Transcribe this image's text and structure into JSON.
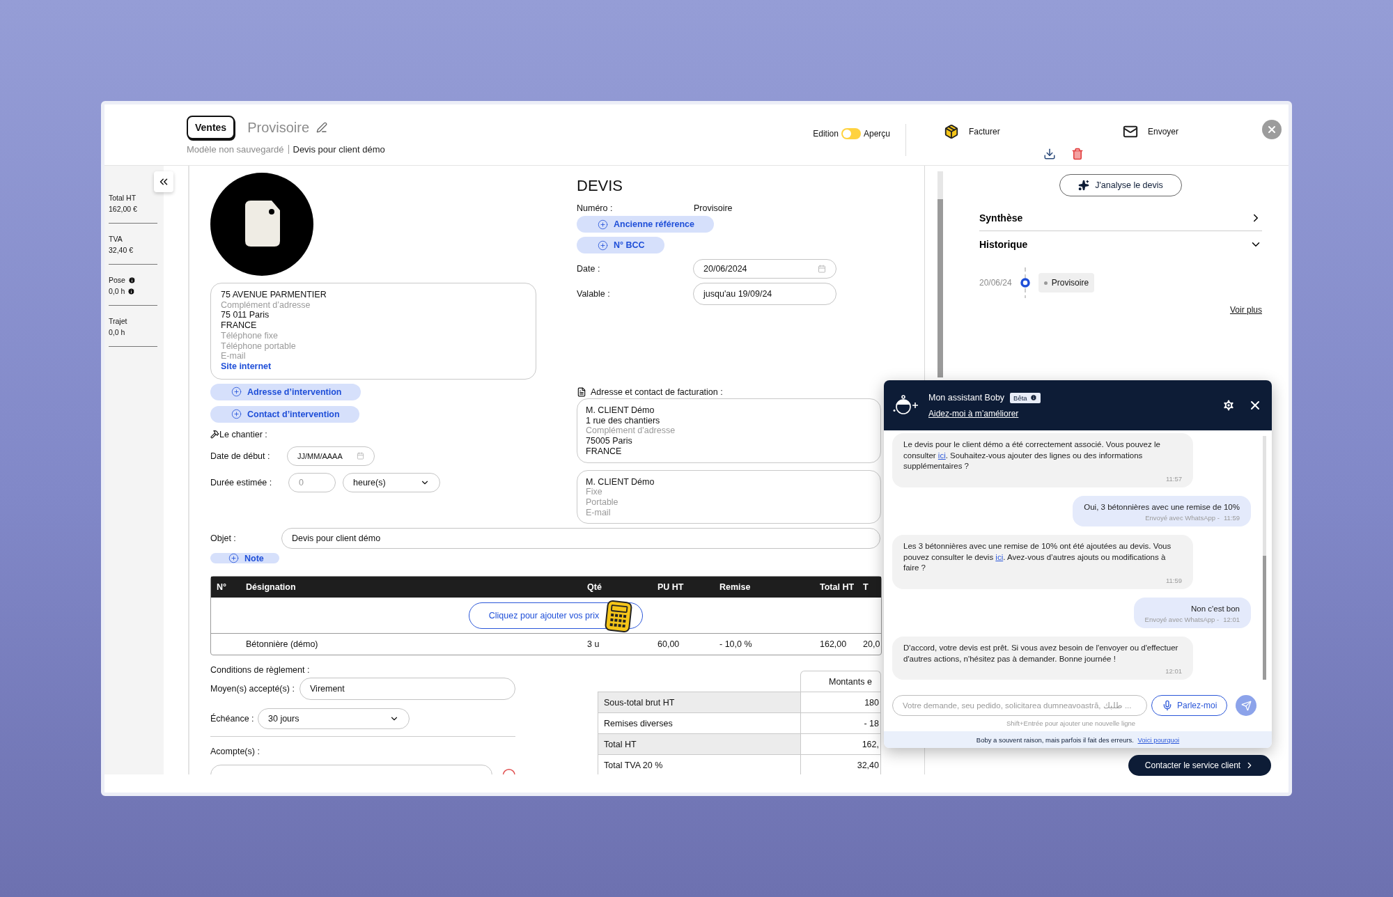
{
  "header": {
    "module": "Ventes",
    "status": "Provisoire",
    "template_note": "Modèle non sauvegardé",
    "document_name": "Devis pour client démo",
    "mode_toggle": {
      "left_label": "Edition",
      "right_label": "Aperçu",
      "on": false
    },
    "actions": [
      {
        "label": "Facturer",
        "kind": "invoice"
      },
      {
        "label": "Envoyer",
        "kind": "send"
      }
    ]
  },
  "summary_sidebar": [
    {
      "label": "Total HT",
      "value": "162,00 €",
      "info": false
    },
    {
      "label": "TVA",
      "value": "32,40 €",
      "info": false
    },
    {
      "label": "Pose",
      "value": "0,0 h",
      "info": true
    },
    {
      "label": "Trajet",
      "value": "0,0 h",
      "info": false
    }
  ],
  "company": {
    "lines": [
      {
        "text": "75 AVENUE PARMENTIER",
        "kind": "value"
      },
      {
        "text": "Complément d’adresse",
        "kind": "placeholder"
      },
      {
        "text": "75 011 Paris",
        "kind": "value"
      },
      {
        "text": "FRANCE",
        "kind": "value"
      },
      {
        "text": "Téléphone fixe",
        "kind": "placeholder"
      },
      {
        "text": "Téléphone portable",
        "kind": "placeholder"
      },
      {
        "text": "E-mail",
        "kind": "placeholder"
      },
      {
        "text": "Site internet",
        "kind": "link"
      }
    ]
  },
  "intervention_buttons": [
    "Adresse d’intervention",
    "Contact d’intervention"
  ],
  "site": {
    "title": "Le chantier :",
    "start_label": "Date de début :",
    "start_placeholder": "JJ/MM/AAAA",
    "duration_label": "Durée estimée :",
    "duration_placeholder": "0",
    "unit": "heure(s)"
  },
  "document": {
    "title": "DEVIS",
    "number_label": "Numéro :",
    "number": "Provisoire",
    "ref_buttons": [
      "Ancienne référence",
      "N° BCC"
    ],
    "date_label": "Date :",
    "date": "20/06/2024",
    "validity_label": "Valable :",
    "validity": "jusqu'au 19/09/24"
  },
  "billing": {
    "title": "Adresse et contact de facturation :",
    "address_lines": [
      {
        "text": "M. CLIENT Démo",
        "kind": "value"
      },
      {
        "text": "1 rue des chantiers",
        "kind": "value"
      },
      {
        "text": "Complément d'adresse",
        "kind": "placeholder"
      },
      {
        "text": "75005  Paris",
        "kind": "value"
      },
      {
        "text": "FRANCE",
        "kind": "value"
      }
    ],
    "contact_lines": [
      {
        "text": "M.  CLIENT Démo",
        "kind": "value"
      },
      {
        "text": "Fixe",
        "kind": "placeholder"
      },
      {
        "text": "Portable",
        "kind": "placeholder"
      },
      {
        "text": "E-mail",
        "kind": "placeholder"
      }
    ]
  },
  "object": {
    "label": "Objet :",
    "value": "Devis pour client démo"
  },
  "note_button": "Note",
  "lines_table": {
    "columns": [
      "N°",
      "Désignation",
      "Qté",
      "PU HT",
      "Remise",
      "Total HT",
      "T"
    ],
    "add_prices_button": "Cliquez pour ajouter vos prix",
    "rows": [
      {
        "designation": "Bétonnière (démo)",
        "qty": "3 u",
        "unit_price": "60,00",
        "discount": "- 10,0 %",
        "total": "162,00",
        "column_7": "20,0"
      }
    ]
  },
  "payment": {
    "title": "Conditions de règlement :",
    "methods_label": "Moyen(s) accepté(s) :",
    "methods": "Virement",
    "due_label": "Échéance :",
    "due": "30 jours",
    "deposit_label": "Acompte(s) :"
  },
  "totals": {
    "header": "Montants e",
    "rows": [
      {
        "label": "Sous-total brut HT",
        "value": "180",
        "shaded": true
      },
      {
        "label": "Remises diverses",
        "value": "- 18",
        "shaded": false
      },
      {
        "label": "Total HT",
        "value": "162,",
        "shaded": true
      },
      {
        "label": "Total TVA 20 %",
        "value": "32,40",
        "shaded": false
      }
    ]
  },
  "side_panel": {
    "analyse_button": "J'analyse le devis",
    "sections": [
      {
        "title": "Synthèse",
        "expanded": false
      },
      {
        "title": "Historique",
        "expanded": true,
        "entries": [
          {
            "date": "20/06/24",
            "status": "Provisoire"
          }
        ],
        "more_link": "Voir plus"
      }
    ]
  },
  "assistant": {
    "title": "Mon assistant Boby",
    "badge": "Bêta",
    "feedback_link": "Aidez-moi à m’améliorer",
    "messages": [
      {
        "kind": "bot",
        "parts": [
          {
            "kind": "text",
            "text": "Le devis pour le client démo a été correctement associé. Vous pouvez le consulter "
          },
          {
            "kind": "link",
            "text": "ici"
          },
          {
            "kind": "text",
            "text": ". Souhaitez-vous ajouter des lignes ou des informations supplémentaires ?"
          }
        ],
        "time": "11:57"
      },
      {
        "kind": "user",
        "parts": [
          {
            "kind": "text",
            "text": "Oui, 3 bétonnières avec une remise de 10%"
          }
        ],
        "channel": "Envoyé avec WhatsApp -",
        "time": "11:59"
      },
      {
        "kind": "bot",
        "parts": [
          {
            "kind": "text",
            "text": "Les 3 bétonnières avec une remise de 10% ont été ajoutées au devis. Vous pouvez consulter le devis "
          },
          {
            "kind": "link",
            "text": "ici"
          },
          {
            "kind": "text",
            "text": ". Avez-vous d’autres ajouts ou modifications à faire ?"
          }
        ],
        "time": "11:59"
      },
      {
        "kind": "user",
        "parts": [
          {
            "kind": "text",
            "text": "Non c'est bon"
          }
        ],
        "channel": "Envoyé avec WhatsApp -",
        "time": "12:01"
      },
      {
        "kind": "bot",
        "parts": [
          {
            "kind": "text",
            "text": "D'accord, votre devis est prêt. Si vous avez besoin de l'envoyer ou d'effectuer d'autres actions, n'hésitez pas à demander. Bonne journée !"
          }
        ],
        "time": "12:01"
      }
    ],
    "input_placeholder": "Votre demande, seu pedido, solicitarea dumneavoastră, طلبك ...",
    "voice_button": "Parlez-moi",
    "hint": "Shift+Entrée pour ajouter une nouvelle ligne",
    "disclaimer": "Boby a souvent raison, mais parfois il fait des erreurs. ",
    "disclaimer_link": "Voici pourquoi"
  },
  "support_button": "Contacter le service client"
}
